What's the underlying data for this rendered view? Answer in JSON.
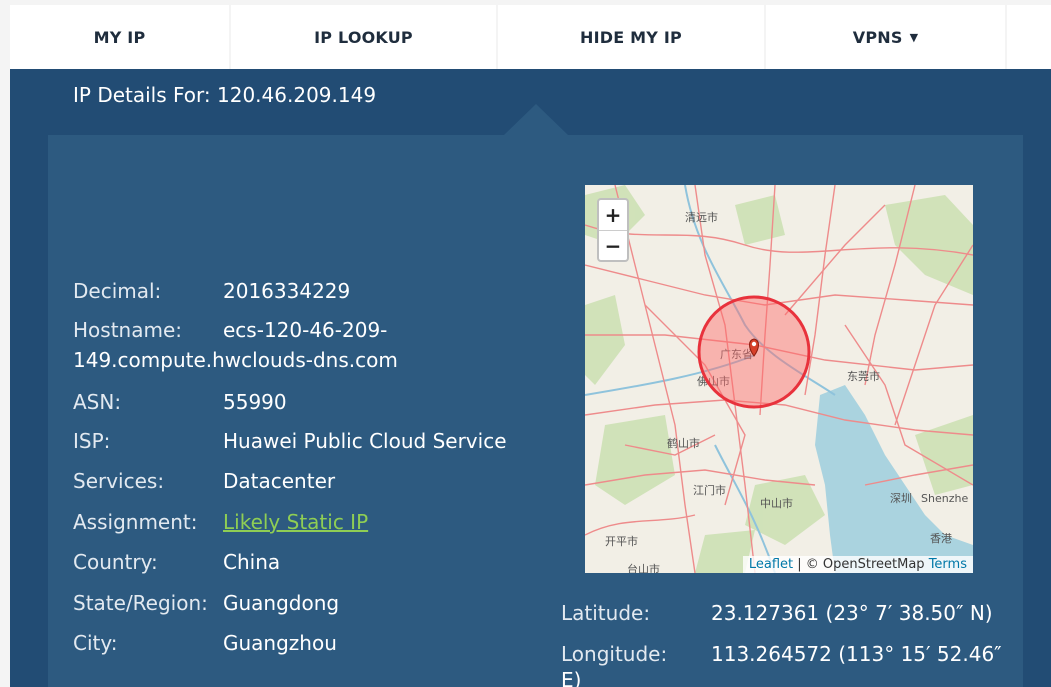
{
  "nav": {
    "items": [
      "MY IP",
      "IP LOOKUP",
      "HIDE MY IP",
      "VPNS"
    ],
    "vpns_caret": "▼"
  },
  "title": "IP Details For: 120.46.209.149",
  "details": {
    "decimal_label": "Decimal:",
    "decimal": "2016334229",
    "hostname_label": "Hostname:",
    "hostname_line1": "ecs-120-46-209-",
    "hostname_line2": "149.compute.hwclouds-dns.com",
    "asn_label": "ASN:",
    "asn": "55990",
    "isp_label": "ISP:",
    "isp": "Huawei Public Cloud Service",
    "services_label": "Services:",
    "services": "Datacenter",
    "assignment_label": "Assignment:",
    "assignment": "Likely Static IP",
    "country_label": "Country:",
    "country": "China",
    "state_label": "State/Region:",
    "state": "Guangdong",
    "city_label": "City:",
    "city": "Guangzhou"
  },
  "map": {
    "zoom_in": "+",
    "zoom_out": "−",
    "attribution_leaflet": "Leaflet",
    "attribution_sep": " | © OpenStreetMap ",
    "attribution_terms": "Terms",
    "place_labels": [
      "清远市",
      "广东省",
      "佛山市",
      "东莞市",
      "鹤山市",
      "江门市",
      "中山市",
      "深圳",
      "Shenzhe",
      "香港",
      "开平市",
      "台山市"
    ],
    "colors": {
      "radius_fill": "#ff6b6b",
      "radius_stroke": "#e8323c",
      "roads": "#f08a8a",
      "water": "#aad3df",
      "land": "#f2efe6",
      "green": "#c8dfae"
    }
  },
  "coords": {
    "lat_label": "Latitude:",
    "lat": "23.127361  (23° 7′ 38.50″ N)",
    "lon_label": "Longitude:",
    "lon": "113.264572  (113° 15′ 52.46″",
    "lon_cont": "E)"
  },
  "colors": {
    "panel": "#224c74",
    "card": "#2d5a80",
    "link": "#8fce54"
  }
}
